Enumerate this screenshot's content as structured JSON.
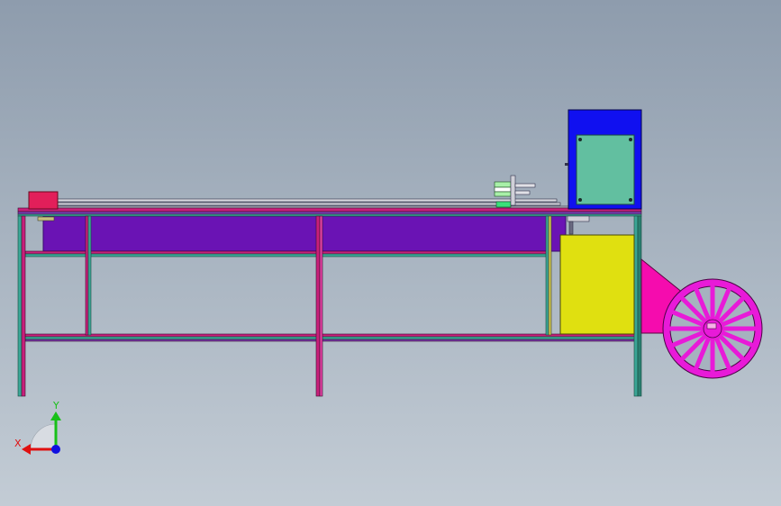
{
  "triad": {
    "x_label": "X",
    "y_label": "Y"
  },
  "colors": {
    "background_top": "#8e9cad",
    "background_bottom": "#c3ccd5",
    "frame_magenta": "#c8207a",
    "frame_teal": "#3aa595",
    "conveyor_tank": "#6a13b4",
    "control_box": "#1010f0",
    "control_panel": "#62bfa0",
    "motor_block": "#e0e010",
    "gear_guard": "#f50cae",
    "wheel": "#e81ad8",
    "red_box": "#e21f5a",
    "x_axis": "#e01010",
    "y_axis": "#18c018",
    "z_axis": "#1010e0"
  }
}
